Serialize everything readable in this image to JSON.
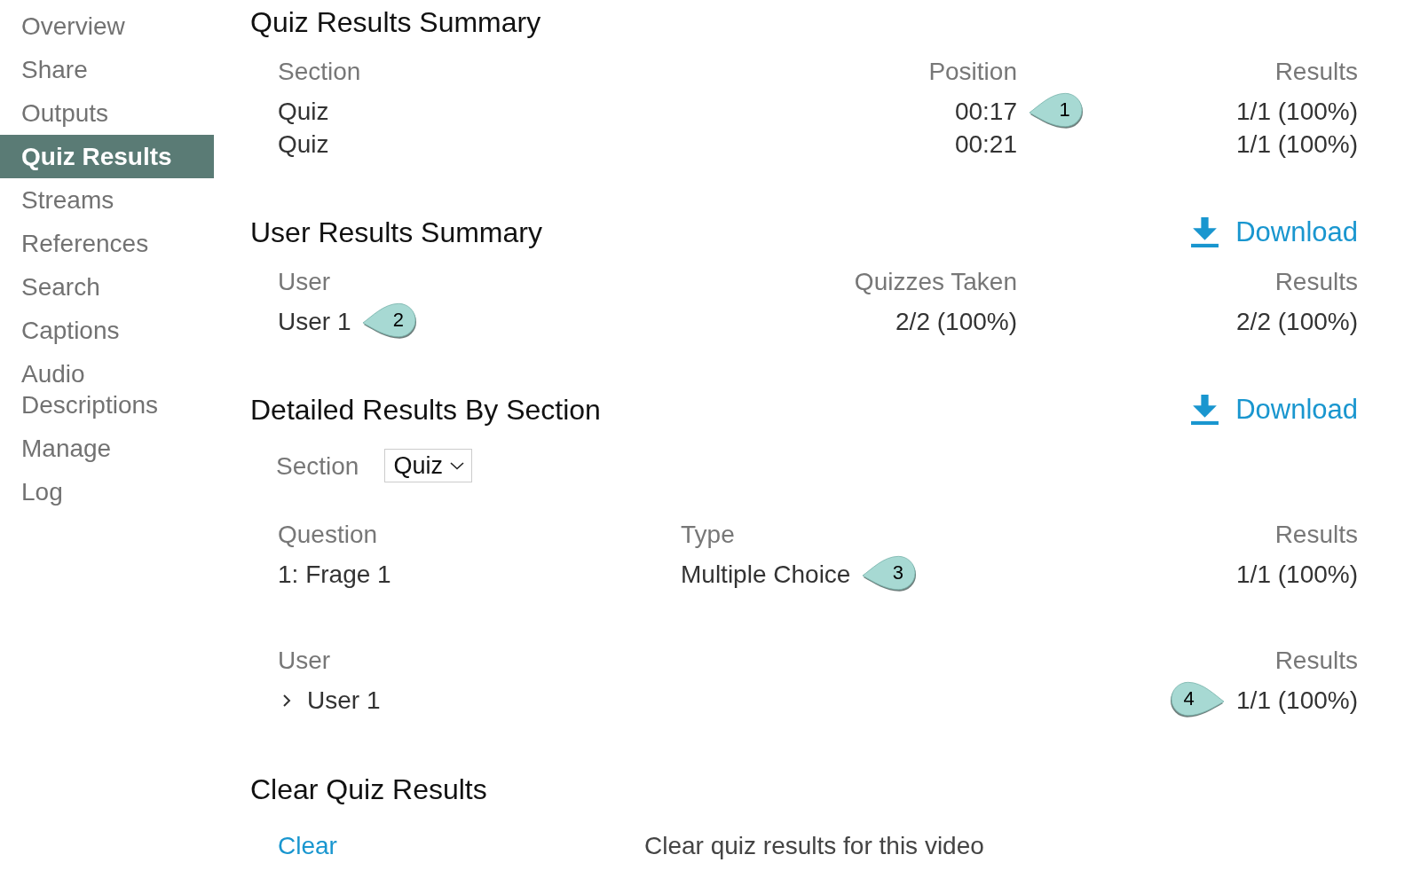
{
  "sidebar": {
    "items": [
      {
        "label": "Overview",
        "selected": false
      },
      {
        "label": "Share",
        "selected": false
      },
      {
        "label": "Outputs",
        "selected": false
      },
      {
        "label": "Quiz Results",
        "selected": true
      },
      {
        "label": "Streams",
        "selected": false
      },
      {
        "label": "References",
        "selected": false
      },
      {
        "label": "Search",
        "selected": false
      },
      {
        "label": "Captions",
        "selected": false
      },
      {
        "label": "Audio Descriptions",
        "selected": false
      },
      {
        "label": "Manage",
        "selected": false
      },
      {
        "label": "Log",
        "selected": false
      }
    ]
  },
  "quiz_results_summary": {
    "title": "Quiz Results Summary",
    "columns": [
      "Section",
      "Position",
      "Results"
    ],
    "rows": [
      {
        "cells": [
          {
            "text": "Quiz"
          },
          {
            "text": "00:17",
            "callout": {
              "label": "1",
              "kind": "left"
            }
          },
          {
            "text": "1/1 (100%)"
          }
        ]
      },
      {
        "cells": [
          {
            "text": "Quiz"
          },
          {
            "text": "00:21"
          },
          {
            "text": "1/1 (100%)"
          }
        ]
      }
    ]
  },
  "user_results_summary": {
    "title": "User Results Summary",
    "download": "Download",
    "columns": [
      "User",
      "Quizzes Taken",
      "Results"
    ],
    "rows": [
      {
        "cells": [
          {
            "text": "User 1",
            "callout": {
              "label": "2",
              "kind": "left"
            }
          },
          {
            "text": "2/2 (100%)"
          },
          {
            "text": "2/2 (100%)"
          }
        ]
      }
    ]
  },
  "detailed_results_by_section": {
    "title": "Detailed Results By Section",
    "download": "Download",
    "section_filter": {
      "label": "Section",
      "value": "Quiz"
    },
    "questions": {
      "columns": [
        "Question",
        "Type",
        "Results"
      ],
      "rows": [
        {
          "cells": [
            {
              "text": "1: Frage 1"
            },
            {
              "text": "Multiple Choice",
              "callout": {
                "label": "3",
                "kind": "left"
              }
            },
            {
              "text": "1/1 (100%)"
            }
          ]
        }
      ]
    },
    "users": {
      "columns": [
        "User",
        "Results"
      ],
      "rows": [
        {
          "expanded": false,
          "cells": [
            {
              "text": "User 1"
            },
            {
              "text": "1/1 (100%)",
              "callout": {
                "label": "4",
                "kind": "right"
              }
            }
          ]
        }
      ]
    }
  },
  "clear_quiz_results": {
    "title": "Clear Quiz Results",
    "action": "Clear",
    "description": "Clear quiz results for this video"
  }
}
